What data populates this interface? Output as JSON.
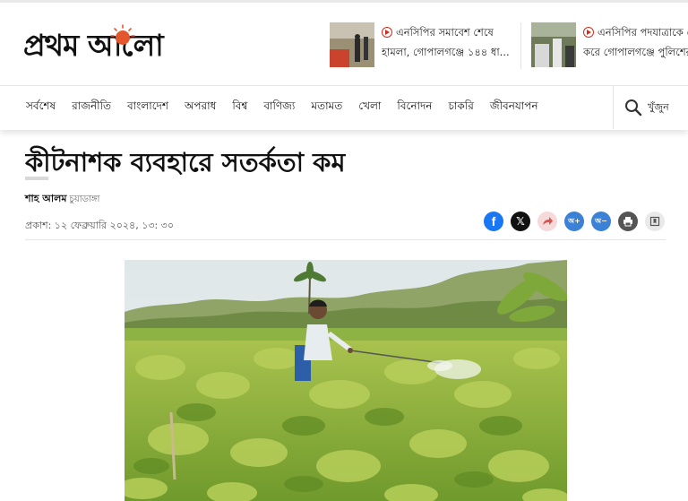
{
  "header": {
    "logo_text": "প্রথম আলো",
    "teasers": [
      {
        "line1": "এনসিপির সমাবেশ শেষে",
        "line2": "হামলা, গোপালগঞ্জে ১৪৪ ধা..."
      },
      {
        "line1": "এনসিপির পদযাত্রাকে কে",
        "line2": "করে গোপালগঞ্জে পুলিশের"
      }
    ]
  },
  "nav": {
    "items": [
      "সর্বশেষ",
      "রাজনীতি",
      "বাংলাদেশ",
      "অপরাধ",
      "বিশ্ব",
      "বাণিজ্য",
      "মতামত",
      "খেলা",
      "বিনোদন",
      "চাকরি",
      "জীবনযাপন"
    ],
    "search_label": "খুঁজুন"
  },
  "article": {
    "headline": "কীটনাশক ব্যবহারে সতর্কতা কম",
    "author": "শাহ আলম",
    "location": "চুয়াডাঙ্গা",
    "published": "প্রকাশ: ১২ ফেব্রুয়ারি ২০২৪, ১৩: ৩০"
  },
  "share": {
    "facebook": "f",
    "x": "𝕏",
    "font_increase": "অ+",
    "font_decrease": "অ−"
  },
  "colors": {
    "brand_red": "#d42c1e",
    "facebook": "#1877f2",
    "x": "#111111",
    "share": "#f4d5d5",
    "font_buttons": "#3b82d6",
    "print": "#555555"
  }
}
